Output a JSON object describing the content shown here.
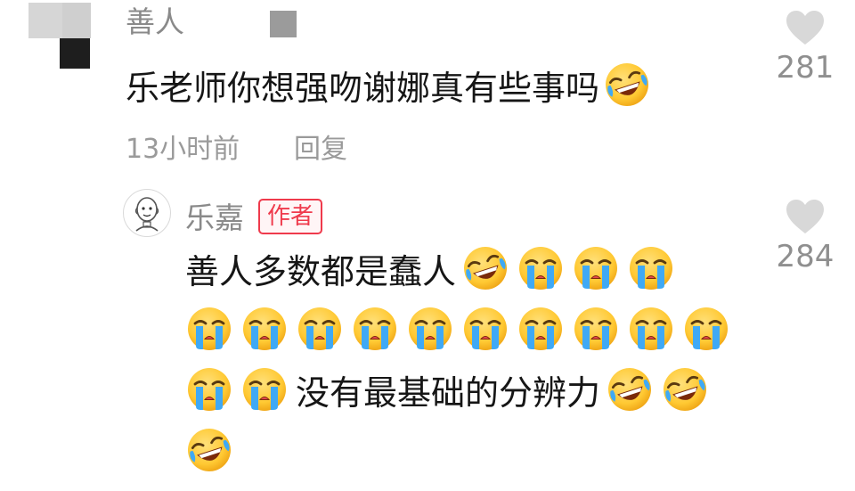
{
  "comment1": {
    "username": "善人",
    "text": "乐老师你想强吻谢娜真有些事吗",
    "timestamp": "13小时前",
    "reply_label": "回复",
    "like_count": "281"
  },
  "comment2": {
    "username": "乐嘉",
    "author_badge": "作者",
    "line1_text": "善人多数都是蠢人",
    "line3_text": "没有最基础的分辨力",
    "like_count": "284"
  },
  "colors": {
    "badge_red": "#ef3a4c",
    "emoji_yellow": "#ffcc33",
    "tear_blue": "#3fa9f5"
  },
  "icons": [
    "heart-icon",
    "laughing-crying-emoji",
    "loudly-crying-emoji"
  ]
}
